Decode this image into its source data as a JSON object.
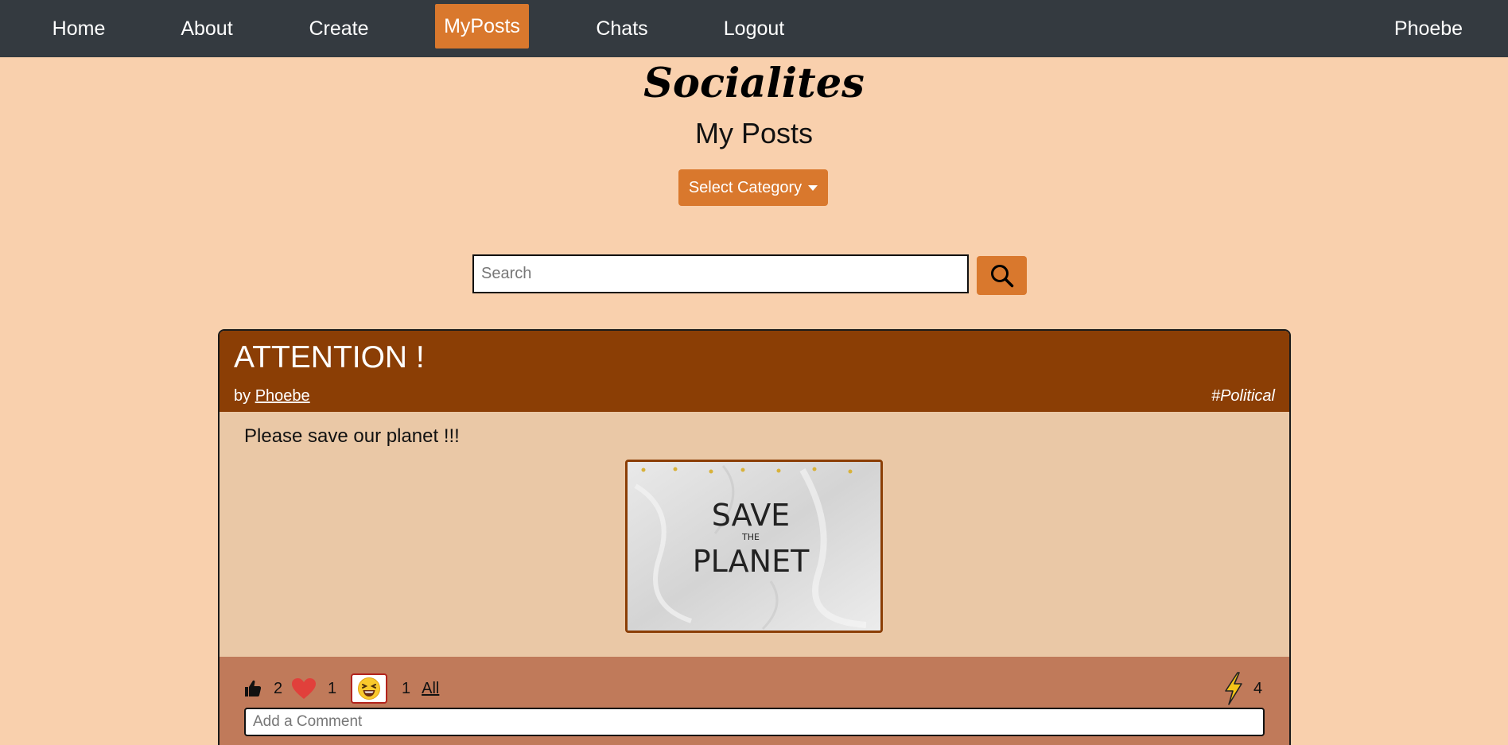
{
  "nav": {
    "items": [
      {
        "label": "Home"
      },
      {
        "label": "About"
      },
      {
        "label": "Create"
      },
      {
        "label": "MyPosts"
      },
      {
        "label": "Chats"
      },
      {
        "label": "Logout"
      }
    ],
    "active": "MyPosts",
    "user": "Phoebe"
  },
  "header": {
    "brand": "Socialites",
    "title": "My Posts",
    "category_button": "Select Category"
  },
  "search": {
    "placeholder": "Search"
  },
  "post": {
    "title": "ATTENTION !",
    "by_prefix": "by",
    "author": "Phoebe",
    "tag": "#Political",
    "text": "Please save our planet !!!",
    "image_alt": "SAVE THE PLANET sign",
    "image_text": {
      "line1": "SAVE",
      "line2": "THE",
      "line3": "PLANET"
    },
    "reactions": {
      "like_count": "2",
      "love_count": "1",
      "laugh_count": "1",
      "all_label": "All",
      "boost_count": "4"
    },
    "comment_placeholder": "Add a Comment"
  },
  "colors": {
    "page_bg": "#f9d0ad",
    "navbar": "#343a40",
    "accent": "#d9782d",
    "card_header": "#8b3e05",
    "card_body": "#eac8a6",
    "card_footer": "#c07a5a"
  }
}
